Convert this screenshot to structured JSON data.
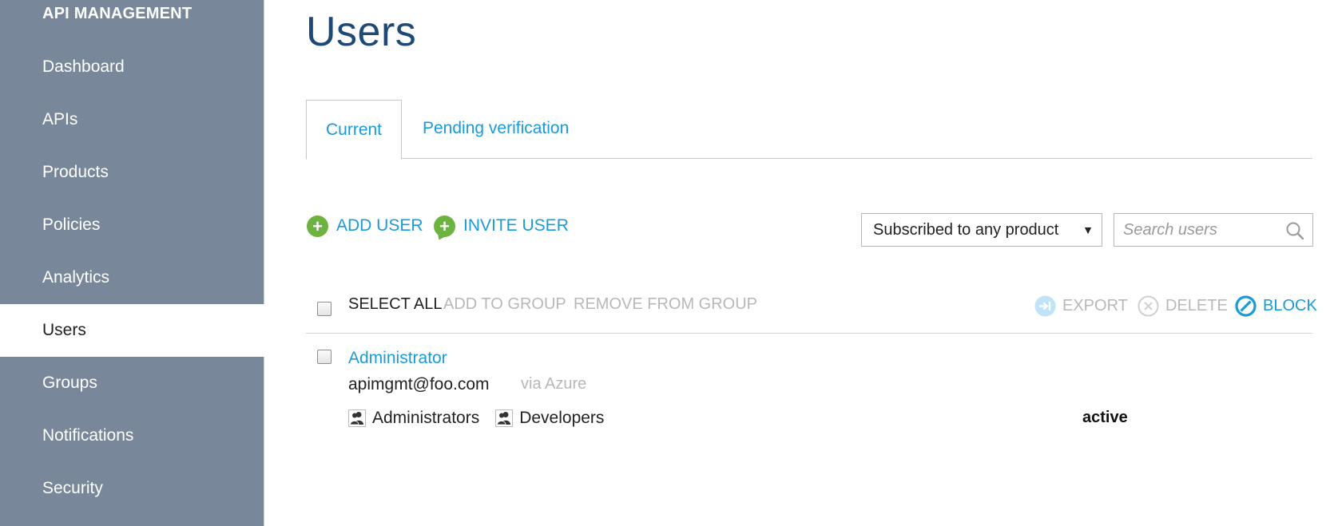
{
  "sidebar": {
    "brand": "API MANAGEMENT",
    "items": [
      {
        "label": "Dashboard"
      },
      {
        "label": "APIs"
      },
      {
        "label": "Products"
      },
      {
        "label": "Policies"
      },
      {
        "label": "Analytics"
      },
      {
        "label": "Users",
        "active": true
      },
      {
        "label": "Groups"
      },
      {
        "label": "Notifications"
      },
      {
        "label": "Security"
      }
    ]
  },
  "page": {
    "title": "Users",
    "tabs": [
      {
        "label": "Current",
        "active": true
      },
      {
        "label": "Pending verification"
      }
    ]
  },
  "toolbar": {
    "add_user": "ADD USER",
    "invite_user": "INVITE USER",
    "filter_selected": "Subscribed to any product",
    "search_placeholder": "Search users"
  },
  "bulk_actions": {
    "select_all": "SELECT ALL",
    "add_to_group": "ADD TO GROUP",
    "remove_from_group": "REMOVE FROM GROUP",
    "export": "EXPORT",
    "delete": "DELETE",
    "block": "BLOCK"
  },
  "users": [
    {
      "name": "Administrator",
      "email": "apimgmt@foo.com",
      "via": "via Azure",
      "groups": [
        "Administrators",
        "Developers"
      ],
      "status": "active"
    }
  ],
  "colors": {
    "sidebar_bg": "#78889a",
    "accent": "#1a9bd7",
    "title": "#1f4a76",
    "add_green": "#6cb33f",
    "disabled": "#b8b8b8"
  }
}
